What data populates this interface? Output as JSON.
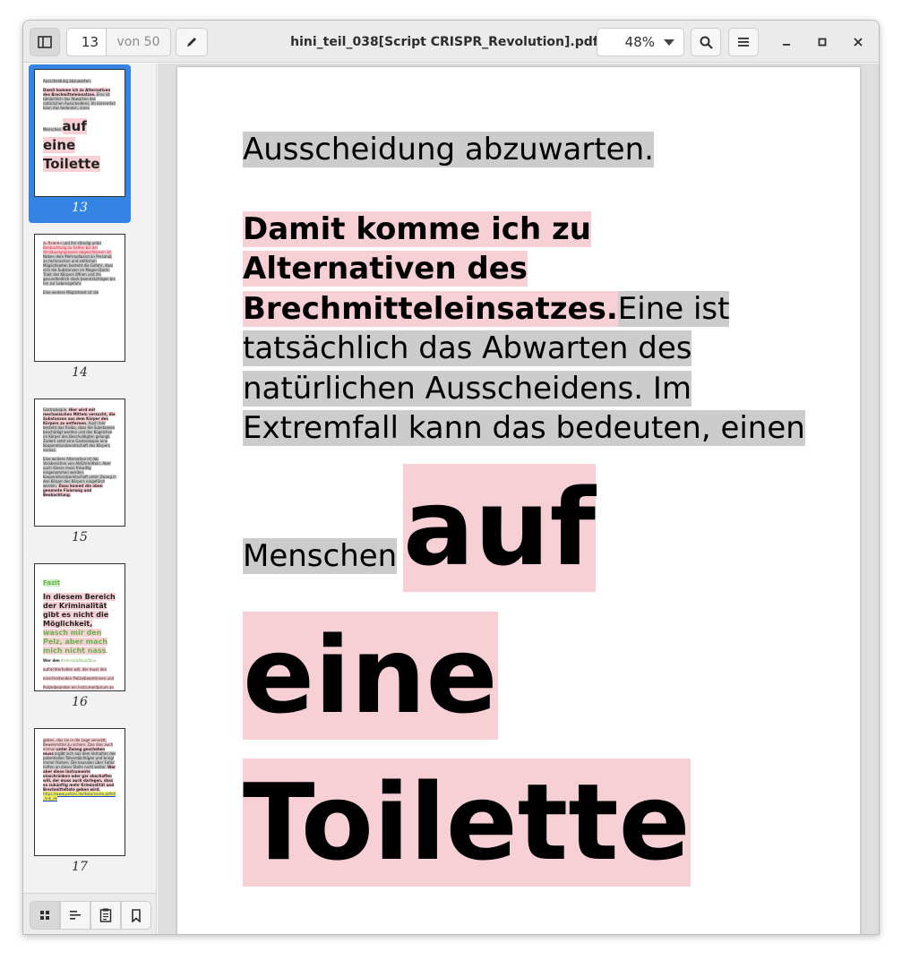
{
  "window": {
    "title": "hini_teil_038[Script CRISPR_Revolution].pdf",
    "page_current": "13",
    "page_total_label": "von 50",
    "zoom_level": "48%"
  },
  "icons": {
    "sidebar_toggle": "sidebar-icon",
    "annotate": "pencil-icon",
    "search": "search-icon",
    "menu": "hamburger-icon",
    "minimize": "minimize-icon",
    "maximize": "maximize-icon",
    "close": "close-icon"
  },
  "sidebar": {
    "thumbnails": [
      {
        "number": "13"
      },
      {
        "number": "14"
      },
      {
        "number": "15"
      },
      {
        "number": "16"
      },
      {
        "number": "17"
      }
    ],
    "tabs": [
      "thumbnails-icon",
      "outline-icon",
      "annotations-icon",
      "bookmarks-icon"
    ]
  },
  "thumb_text": {
    "t13": {
      "l1": "Ausscheidung abzuwarten.",
      "l2": "Damit komme ich zu Alternativen des Brechmitteleinsatzes.",
      "l3": " Eine ist tatsächlich das Abwarten des natürlichen Ausscheidens. Im Extremfall kann das bedeuten, einen",
      "l4": "Menschen ",
      "l5": "auf eine Toilette"
    },
    "t14": {
      "l1": "zu fixieren",
      "l2": " und ihn ständig unter ",
      "l3": "Beobachtung zu halten bis der Verdauungsprozess abgeschlossen ist.",
      "l4": " Neben dem Mehraufwand an Personal, an technischen und zeitlichen Möglichkeiten besteht die Gefahr, dass sich die Substanzen im Magen-Darm-Trakt des Körpers öffnen und ihn gesundheitlich stark beeinträchtigen bis hin zur Lebensgefahr.",
      "l5": "Eine weitere Möglichkeit ist die"
    },
    "t15": {
      "l1": "Gastroskopie.",
      "l2": " Hier wird mit mechanischen Mitteln versucht, die Substanzen aus dem Körper des Körpers zu entfernen.",
      "l3": " Auch hier besteht das Risiko, dass die Substanzen beschädigt werden und das Kügelchen im Körper des Beschuldigten gelangt. Zudem setzt eine Gastroskopie eine Kooperationsbereitschaft des Körpers voraus.",
      "l4": "Eine weitere Alternative ist das Verabreichen von Abführmitteln. Aber auch dieses muss freiwillig eingenommen werden. Kooperationsbereitschaft unter Zwang in den Körper des Körpers eingeführt werden.",
      "l5": " Dazu kommt die oben genannte Fixierung und Beobachtung."
    },
    "t16": {
      "l1": "Fazit",
      "l2": "In diesem Bereich der Kriminalität gibt es nicht die Möglichkeit, ",
      "l3": "wasch mir den Pelz, aber mach mich nicht nass",
      "l4": ". Wer den ",
      "l5": "Kriminalitätsaufbau",
      "l6": " aufrechterhalten will, der muss den einschreitenden Polizeibeamtinnen und Polizeibeamten ein Instrumentarium an die Hand"
    },
    "t17": {
      "l1": "geben, das sie in die Lage versetzt, Beweismittel zu sichern. Das dies auch einmal ",
      "l2": "unter Zwang geschehen muss",
      "l3": " ergibt sich aus dem Verhalten des potentiellen Tatverdächtigen und bringt immer Risiken. Die kausalen über Folter helfen an dieser Stelle nicht weiter. ",
      "l4": "Wer aber diese Instrumente einschränken oder gar abschaffen will, der muss auch darlegen, dass es zukünftig mehr Kriminalität und Brechmitteltote geben wird.",
      "l5": " https://www.polizei.de/dokumente.pdf/dl_link_de"
    }
  },
  "document": {
    "lines": [
      "Ausscheidung abzuwarten. ",
      "Damit komme ich zu ",
      "Alternativen des ",
      "Brechmitteleinsatzes.",
      " Eine ist ",
      "tatsächlich das Abwarten des ",
      "natürlichen Ausscheidens. Im ",
      "Extremfall kann das bedeuten, einen",
      "Menschen ",
      "auf ",
      "eine ",
      "Toilette "
    ]
  },
  "colors": {
    "highlight_gray": "#cccccc",
    "highlight_pink": "#f7d0d6",
    "selection_blue": "#3584e4"
  }
}
